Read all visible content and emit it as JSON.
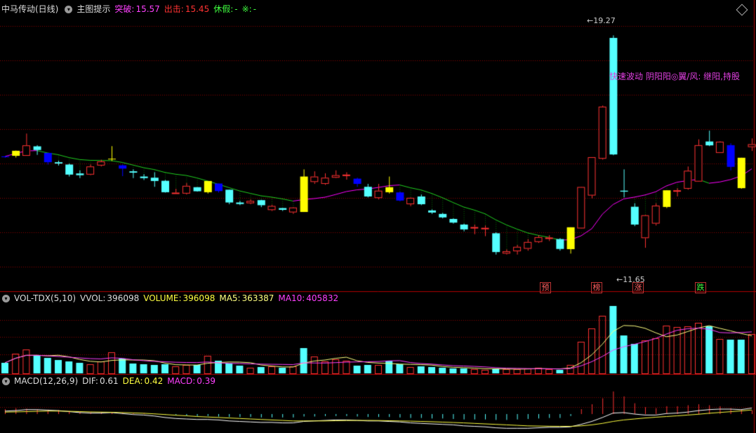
{
  "main_header": {
    "stock_name": "中马传动(日线)",
    "indicator": "主图提示",
    "breakout_label": "突破:",
    "breakout_value": "15.57",
    "exit_label": "出击:",
    "exit_value": "15.45",
    "rest_label": "休假:",
    "rest_value": "-",
    "star_label": "※:",
    "star_value": "-"
  },
  "annotations": {
    "high_price": "19.27",
    "low_price": "11.65",
    "note": "快速波动 阴阳阳◎翼/风: 继阳,持股",
    "signals": [
      {
        "text": "预",
        "color": "#ff6060"
      },
      {
        "text": "榜",
        "color": "#ff6060"
      },
      {
        "text": "涨",
        "color": "#ff6060"
      },
      {
        "text": "跌",
        "color": "#40ff40"
      }
    ]
  },
  "vol_header": {
    "name": "VOL-TDX(5,10)",
    "vvol_label": "VVOL:",
    "vvol_value": "396098",
    "volume_label": "VOLUME:",
    "volume_value": "396098",
    "ma5_label": "MA5:",
    "ma5_value": "363387",
    "ma10_label": "MA10:",
    "ma10_value": "405832"
  },
  "macd_header": {
    "name": "MACD(12,26,9)",
    "dif_label": "DIF:",
    "dif_value": "0.61",
    "dea_label": "DEA:",
    "dea_value": "0.42",
    "macd_label": "MACD:",
    "macd_value": "0.39"
  },
  "colors": {
    "up": "#ff3232",
    "down": "#54ffff",
    "yellow": "#ffff00",
    "blue": "#0000ff",
    "ma_line": "#ff00ff",
    "green_fill": "#00c000",
    "grid": "#8b0000",
    "vol_ma5": "#ffff80",
    "vol_ma10": "#ff40ff"
  },
  "chart_data": {
    "type": "candlestick",
    "candles": [
      {
        "o": 12.98,
        "c": 13.02,
        "h": 13.05,
        "l": 12.95,
        "k": "blue"
      },
      {
        "o": 13.05,
        "c": 13.31,
        "h": 13.32,
        "l": 12.96,
        "k": "yellow"
      },
      {
        "o": 13.05,
        "c": 13.59,
        "h": 14.2,
        "l": 13.05,
        "k": "up"
      },
      {
        "o": 13.54,
        "c": 13.35,
        "h": 13.6,
        "l": 13.1,
        "k": "down"
      },
      {
        "o": 13.2,
        "c": 12.72,
        "h": 13.2,
        "l": 12.6,
        "k": "blue"
      },
      {
        "o": 12.72,
        "c": 12.65,
        "h": 12.8,
        "l": 12.55,
        "k": "down"
      },
      {
        "o": 12.6,
        "c": 12.08,
        "h": 12.65,
        "l": 11.98,
        "k": "down"
      },
      {
        "o": 12.05,
        "c": 12.14,
        "h": 12.3,
        "l": 11.9,
        "k": "down"
      },
      {
        "o": 12.08,
        "c": 12.5,
        "h": 12.6,
        "l": 12.05,
        "k": "up"
      },
      {
        "o": 12.55,
        "c": 12.76,
        "h": 12.85,
        "l": 12.5,
        "k": "up"
      },
      {
        "o": 12.87,
        "c": 12.9,
        "h": 13.55,
        "l": 12.78,
        "k": "yellow"
      },
      {
        "o": 12.56,
        "c": 12.39,
        "h": 12.6,
        "l": 12.0,
        "k": "blue"
      },
      {
        "o": 12.18,
        "c": 12.25,
        "h": 12.35,
        "l": 11.9,
        "k": "down"
      },
      {
        "o": 11.9,
        "c": 11.98,
        "h": 12.1,
        "l": 11.8,
        "k": "down"
      },
      {
        "o": 11.92,
        "c": 11.75,
        "h": 12.2,
        "l": 11.45,
        "k": "down"
      },
      {
        "o": 11.76,
        "c": 11.17,
        "h": 11.8,
        "l": 11.15,
        "k": "down"
      },
      {
        "o": 11.1,
        "c": 11.15,
        "h": 11.35,
        "l": 11.1,
        "k": "up"
      },
      {
        "o": 11.1,
        "c": 11.5,
        "h": 11.65,
        "l": 11.05,
        "k": "up"
      },
      {
        "o": 11.43,
        "c": 11.22,
        "h": 11.43,
        "l": 11.2,
        "k": "down"
      },
      {
        "o": 11.75,
        "c": 11.17,
        "h": 11.75,
        "l": 11.1,
        "k": "yellow"
      },
      {
        "o": 11.62,
        "c": 11.23,
        "h": 11.62,
        "l": 11.15,
        "k": "blue"
      },
      {
        "o": 11.3,
        "c": 10.64,
        "h": 11.3,
        "l": 10.55,
        "k": "down"
      },
      {
        "o": 10.64,
        "c": 10.56,
        "h": 10.72,
        "l": 10.5,
        "k": "down"
      },
      {
        "o": 10.6,
        "c": 10.72,
        "h": 10.8,
        "l": 10.55,
        "k": "up"
      },
      {
        "o": 10.76,
        "c": 10.5,
        "h": 10.78,
        "l": 10.4,
        "k": "down"
      },
      {
        "o": 10.25,
        "c": 10.46,
        "h": 10.52,
        "l": 10.2,
        "k": "up"
      },
      {
        "o": 10.35,
        "c": 10.26,
        "h": 10.35,
        "l": 10.2,
        "k": "down"
      },
      {
        "o": 10.13,
        "c": 10.38,
        "h": 10.4,
        "l": 10.05,
        "k": "up"
      },
      {
        "o": 10.15,
        "c": 11.98,
        "h": 12.35,
        "l": 10.15,
        "k": "yellow"
      },
      {
        "o": 11.98,
        "c": 11.7,
        "h": 12.25,
        "l": 11.6,
        "k": "up"
      },
      {
        "o": 11.6,
        "c": 11.92,
        "h": 12.15,
        "l": 11.55,
        "k": "up"
      },
      {
        "o": 11.92,
        "c": 12.05,
        "h": 12.3,
        "l": 11.9,
        "k": "up"
      },
      {
        "o": 12.05,
        "c": 12.08,
        "h": 12.2,
        "l": 11.82,
        "k": "up"
      },
      {
        "o": 11.87,
        "c": 11.6,
        "h": 11.92,
        "l": 11.45,
        "k": "blue"
      },
      {
        "o": 11.45,
        "c": 10.95,
        "h": 11.6,
        "l": 10.9,
        "k": "down"
      },
      {
        "o": 10.87,
        "c": 11.25,
        "h": 11.6,
        "l": 10.8,
        "k": "up"
      },
      {
        "o": 11.43,
        "c": 11.17,
        "h": 11.98,
        "l": 11.1,
        "k": "yellow"
      },
      {
        "o": 11.16,
        "c": 10.74,
        "h": 11.2,
        "l": 10.7,
        "k": "blue"
      },
      {
        "o": 10.88,
        "c": 10.55,
        "h": 10.9,
        "l": 10.45,
        "k": "up"
      },
      {
        "o": 10.95,
        "c": 10.55,
        "h": 11.05,
        "l": 10.5,
        "k": "down"
      },
      {
        "o": 10.23,
        "c": 10.12,
        "h": 10.28,
        "l": 10.05,
        "k": "down"
      },
      {
        "o": 10.05,
        "c": 9.87,
        "h": 10.1,
        "l": 9.82,
        "k": "down"
      },
      {
        "o": 9.79,
        "c": 9.6,
        "h": 9.82,
        "l": 9.55,
        "k": "down"
      },
      {
        "o": 9.5,
        "c": 9.25,
        "h": 9.55,
        "l": 9.15,
        "k": "down"
      },
      {
        "o": 9.34,
        "c": 9.37,
        "h": 9.5,
        "l": 9.0,
        "k": "up"
      },
      {
        "o": 9.29,
        "c": 9.33,
        "h": 9.45,
        "l": 8.9,
        "k": "up"
      },
      {
        "o": 9.05,
        "c": 8.08,
        "h": 9.1,
        "l": 7.95,
        "k": "down"
      },
      {
        "o": 8.0,
        "c": 8.12,
        "h": 8.22,
        "l": 7.95,
        "k": "up"
      },
      {
        "o": 8.12,
        "c": 8.35,
        "h": 8.45,
        "l": 7.95,
        "k": "up"
      },
      {
        "o": 8.25,
        "c": 8.6,
        "h": 8.75,
        "l": 8.15,
        "k": "up"
      },
      {
        "o": 8.6,
        "c": 8.85,
        "h": 8.95,
        "l": 8.55,
        "k": "up"
      },
      {
        "o": 8.8,
        "c": 8.83,
        "h": 8.95,
        "l": 8.65,
        "k": "up"
      },
      {
        "o": 8.75,
        "c": 8.24,
        "h": 8.8,
        "l": 8.15,
        "k": "down"
      },
      {
        "o": 8.23,
        "c": 9.36,
        "h": 9.36,
        "l": 8.0,
        "k": "yellow"
      },
      {
        "o": 9.3,
        "c": 11.44,
        "h": 11.44,
        "l": 9.3,
        "k": "up"
      },
      {
        "o": 11.0,
        "c": 12.98,
        "h": 12.98,
        "l": 10.85,
        "k": "up"
      },
      {
        "o": 12.9,
        "c": 15.59,
        "h": 15.65,
        "l": 12.85,
        "k": "up"
      },
      {
        "o": 19.14,
        "c": 13.12,
        "h": 19.27,
        "l": 13.08,
        "k": "down"
      },
      {
        "o": 11.2,
        "c": 11.25,
        "h": 12.35,
        "l": 10.9,
        "k": "down"
      },
      {
        "o": 10.42,
        "c": 9.5,
        "h": 10.6,
        "l": 9.42,
        "k": "down"
      },
      {
        "o": 8.8,
        "c": 9.98,
        "h": 10.0,
        "l": 8.3,
        "k": "up"
      },
      {
        "o": 9.55,
        "c": 10.48,
        "h": 10.6,
        "l": 9.45,
        "k": "up"
      },
      {
        "o": 10.41,
        "c": 11.27,
        "h": 11.27,
        "l": 10.35,
        "k": "yellow"
      },
      {
        "o": 11.22,
        "c": 11.27,
        "h": 11.38,
        "l": 10.95,
        "k": "up"
      },
      {
        "o": 11.35,
        "c": 12.28,
        "h": 12.5,
        "l": 11.3,
        "k": "up"
      },
      {
        "o": 11.72,
        "c": 13.6,
        "h": 13.9,
        "l": 11.72,
        "k": "up"
      },
      {
        "o": 13.79,
        "c": 13.59,
        "h": 14.35,
        "l": 13.55,
        "k": "down"
      },
      {
        "o": 13.2,
        "c": 13.78,
        "h": 13.8,
        "l": 13.2,
        "k": "up"
      },
      {
        "o": 13.6,
        "c": 12.48,
        "h": 13.7,
        "l": 12.3,
        "k": "blue"
      },
      {
        "o": 12.95,
        "c": 11.38,
        "h": 12.95,
        "l": 11.35,
        "k": "yellow"
      },
      {
        "o": 13.5,
        "c": 13.65,
        "h": 13.95,
        "l": 13.3,
        "k": "up"
      }
    ],
    "price_range": [
      6.6,
      20.3
    ],
    "volume": [
      {
        "v": 15,
        "k": "down"
      },
      {
        "v": 28,
        "k": "up"
      },
      {
        "v": 34,
        "k": "up"
      },
      {
        "v": 26,
        "k": "down"
      },
      {
        "v": 22,
        "k": "down"
      },
      {
        "v": 19,
        "k": "down"
      },
      {
        "v": 17,
        "k": "down"
      },
      {
        "v": 15,
        "k": "down"
      },
      {
        "v": 13,
        "k": "up"
      },
      {
        "v": 17,
        "k": "up"
      },
      {
        "v": 30,
        "k": "up"
      },
      {
        "v": 21,
        "k": "down"
      },
      {
        "v": 14,
        "k": "down"
      },
      {
        "v": 13,
        "k": "down"
      },
      {
        "v": 12,
        "k": "down"
      },
      {
        "v": 13,
        "k": "down"
      },
      {
        "v": 10,
        "k": "up"
      },
      {
        "v": 12,
        "k": "up"
      },
      {
        "v": 12,
        "k": "down"
      },
      {
        "v": 25,
        "k": "up"
      },
      {
        "v": 18,
        "k": "down"
      },
      {
        "v": 14,
        "k": "down"
      },
      {
        "v": 11,
        "k": "down"
      },
      {
        "v": 8,
        "k": "up"
      },
      {
        "v": 9,
        "k": "down"
      },
      {
        "v": 10,
        "k": "up"
      },
      {
        "v": 8,
        "k": "down"
      },
      {
        "v": 10,
        "k": "up"
      },
      {
        "v": 36,
        "k": "down"
      },
      {
        "v": 24,
        "k": "up"
      },
      {
        "v": 17,
        "k": "up"
      },
      {
        "v": 20,
        "k": "up"
      },
      {
        "v": 18,
        "k": "up"
      },
      {
        "v": 11,
        "k": "down"
      },
      {
        "v": 12,
        "k": "down"
      },
      {
        "v": 12,
        "k": "up"
      },
      {
        "v": 18,
        "k": "down"
      },
      {
        "v": 13,
        "k": "down"
      },
      {
        "v": 9,
        "k": "up"
      },
      {
        "v": 10,
        "k": "down"
      },
      {
        "v": 9,
        "k": "down"
      },
      {
        "v": 8,
        "k": "down"
      },
      {
        "v": 7,
        "k": "down"
      },
      {
        "v": 7,
        "k": "down"
      },
      {
        "v": 6,
        "k": "up"
      },
      {
        "v": 5,
        "k": "up"
      },
      {
        "v": 7,
        "k": "down"
      },
      {
        "v": 6,
        "k": "up"
      },
      {
        "v": 6,
        "k": "up"
      },
      {
        "v": 7,
        "k": "up"
      },
      {
        "v": 8,
        "k": "up"
      },
      {
        "v": 6,
        "k": "up"
      },
      {
        "v": 5,
        "k": "down"
      },
      {
        "v": 12,
        "k": "up"
      },
      {
        "v": 45,
        "k": "up"
      },
      {
        "v": 64,
        "k": "up"
      },
      {
        "v": 82,
        "k": "up"
      },
      {
        "v": 96,
        "k": "down"
      },
      {
        "v": 54,
        "k": "down"
      },
      {
        "v": 42,
        "k": "down"
      },
      {
        "v": 47,
        "k": "up"
      },
      {
        "v": 50,
        "k": "up"
      },
      {
        "v": 68,
        "k": "up"
      },
      {
        "v": 66,
        "k": "up"
      },
      {
        "v": 67,
        "k": "up"
      },
      {
        "v": 72,
        "k": "up"
      },
      {
        "v": 67,
        "k": "down"
      },
      {
        "v": 49,
        "k": "up"
      },
      {
        "v": 48,
        "k": "down"
      },
      {
        "v": 48,
        "k": "down"
      },
      {
        "v": 56,
        "k": "up"
      }
    ],
    "macd_hist": [
      0.5,
      0.6,
      0.55,
      0.5,
      0.45,
      0.4,
      0.3,
      0.25,
      0.2,
      0.2,
      0.2,
      0.15,
      0.1,
      0.1,
      0.05,
      -0.05,
      -0.1,
      -0.15,
      -0.2,
      -0.2,
      -0.25,
      -0.3,
      -0.3,
      -0.3,
      -0.35,
      -0.35,
      -0.35,
      -0.35,
      -0.25,
      -0.25,
      -0.2,
      -0.2,
      -0.2,
      -0.25,
      -0.3,
      -0.3,
      -0.3,
      -0.35,
      -0.4,
      -0.4,
      -0.45,
      -0.45,
      -0.5,
      -0.55,
      -0.55,
      -0.55,
      -0.6,
      -0.6,
      -0.55,
      -0.5,
      -0.45,
      -0.4,
      -0.4,
      -0.2,
      0.5,
      1.0,
      1.6,
      2.3,
      1.8,
      1.1,
      0.7,
      0.6,
      0.8,
      0.8,
      0.9,
      1.0,
      0.9,
      0.8,
      0.6,
      0.5,
      0.39
    ],
    "dif": [
      0.3,
      0.35,
      0.45,
      0.45,
      0.4,
      0.35,
      0.25,
      0.15,
      0.1,
      0.1,
      0.15,
      0.05,
      -0.05,
      -0.1,
      -0.2,
      -0.35,
      -0.45,
      -0.5,
      -0.55,
      -0.55,
      -0.6,
      -0.7,
      -0.75,
      -0.8,
      -0.85,
      -0.85,
      -0.9,
      -0.9,
      -0.75,
      -0.7,
      -0.65,
      -0.6,
      -0.6,
      -0.65,
      -0.7,
      -0.7,
      -0.75,
      -0.8,
      -0.9,
      -0.95,
      -1.0,
      -1.05,
      -1.1,
      -1.2,
      -1.25,
      -1.3,
      -1.4,
      -1.45,
      -1.45,
      -1.45,
      -1.4,
      -1.35,
      -1.35,
      -1.3,
      -1.05,
      -0.75,
      -0.35,
      0.1,
      0.15,
      0.0,
      -0.1,
      -0.1,
      0.05,
      0.1,
      0.2,
      0.35,
      0.45,
      0.5,
      0.5,
      0.45,
      0.61
    ],
    "dea": [
      0.2,
      0.22,
      0.25,
      0.28,
      0.3,
      0.3,
      0.28,
      0.25,
      0.22,
      0.2,
      0.18,
      0.15,
      0.12,
      0.08,
      0.02,
      -0.05,
      -0.12,
      -0.18,
      -0.25,
      -0.3,
      -0.35,
      -0.4,
      -0.45,
      -0.5,
      -0.55,
      -0.6,
      -0.65,
      -0.7,
      -0.7,
      -0.7,
      -0.7,
      -0.68,
      -0.66,
      -0.65,
      -0.65,
      -0.66,
      -0.68,
      -0.7,
      -0.72,
      -0.75,
      -0.78,
      -0.82,
      -0.86,
      -0.9,
      -0.95,
      -1.0,
      -1.05,
      -1.1,
      -1.15,
      -1.2,
      -1.22,
      -1.24,
      -1.25,
      -1.25,
      -1.2,
      -1.1,
      -0.95,
      -0.75,
      -0.6,
      -0.5,
      -0.4,
      -0.32,
      -0.25,
      -0.18,
      -0.1,
      -0.02,
      0.08,
      0.16,
      0.24,
      0.32,
      0.42
    ]
  }
}
